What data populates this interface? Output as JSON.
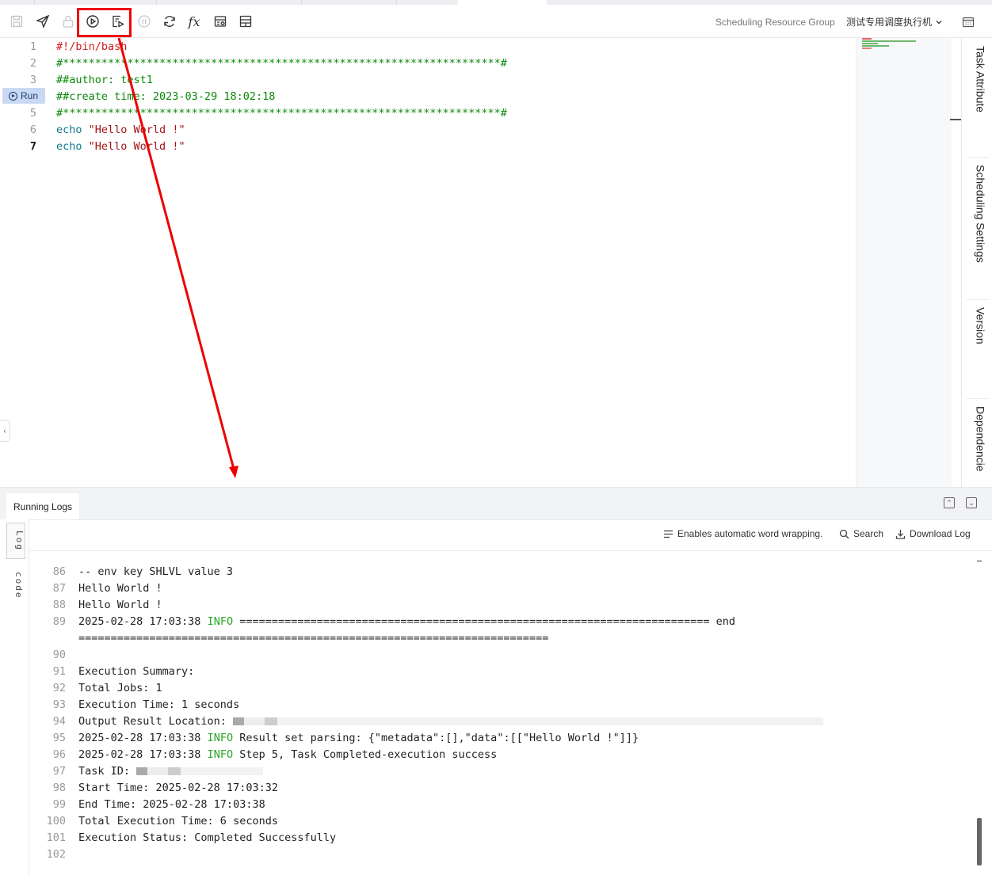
{
  "toolbar": {
    "icons": [
      "save-icon",
      "submit-icon",
      "lock-icon",
      "run-icon",
      "run-with-params-icon",
      "stop-icon",
      "refresh-icon",
      "function-icon",
      "format-icon",
      "table-icon"
    ],
    "resource_group_label": "Scheduling Resource Group",
    "resource_group_value": "测试专用调度执行机",
    "calendar_icon": "calendar-icon"
  },
  "editor": {
    "run_badge_label": "Run",
    "current_line": 7,
    "lines": [
      {
        "num": "1",
        "text": "#!/bin/bash"
      },
      {
        "num": "2",
        "text": "#********************************************************************#"
      },
      {
        "num": "3",
        "text": "##author: test1"
      },
      {
        "num": "4",
        "text": "##create time: 2023-03-29 18:02:18"
      },
      {
        "num": "5",
        "text": "#********************************************************************#"
      },
      {
        "num": "6",
        "keyword": "echo",
        "string": "\"Hello World !\""
      },
      {
        "num": "7",
        "keyword": "echo",
        "string": "\"Hello World !\""
      }
    ]
  },
  "right_panel": {
    "tabs": [
      "Task Attribute",
      "Scheduling Settings",
      "Version",
      "Dependencie"
    ]
  },
  "logs": {
    "tab_label": "Running Logs",
    "side_tabs": [
      "Log",
      "code"
    ],
    "tools": {
      "wrap_label": "Enables automatic word wrapping.",
      "search_label": "Search",
      "download_label": "Download Log"
    },
    "lines": [
      {
        "num": "86",
        "text": "-- env key SHLVL value 3"
      },
      {
        "num": "87",
        "text": "Hello World !"
      },
      {
        "num": "88",
        "text": "Hello World !"
      },
      {
        "num": "89",
        "pre": "2025-02-28 17:03:38 ",
        "level": "INFO",
        "text": " ========================================================================= end"
      },
      {
        "num": "",
        "text": "========================================================================="
      },
      {
        "num": "90",
        "text": ""
      },
      {
        "num": "91",
        "text": "Execution Summary:"
      },
      {
        "num": "92",
        "text": "Total Jobs: 1"
      },
      {
        "num": "93",
        "text": "Execution Time: 1 seconds"
      },
      {
        "num": "94",
        "text": "Output Result Location: "
      },
      {
        "num": "95",
        "pre": "2025-02-28 17:03:38 ",
        "level": "INFO",
        "text": " Result set parsing: {\"metadata\":[],\"data\":[[\"Hello World !\"]]}"
      },
      {
        "num": "96",
        "pre": "2025-02-28 17:03:38 ",
        "level": "INFO",
        "text": " Step 5, Task Completed-execution success"
      },
      {
        "num": "97",
        "text": "Task ID: "
      },
      {
        "num": "98",
        "text": "Start Time: 2025-02-28 17:03:32"
      },
      {
        "num": "99",
        "text": "End Time: 2025-02-28 17:03:38"
      },
      {
        "num": "100",
        "text": "Total Execution Time: 6 seconds"
      },
      {
        "num": "101",
        "text": "Execution Status: Completed Successfully"
      },
      {
        "num": "102",
        "text": ""
      }
    ]
  }
}
